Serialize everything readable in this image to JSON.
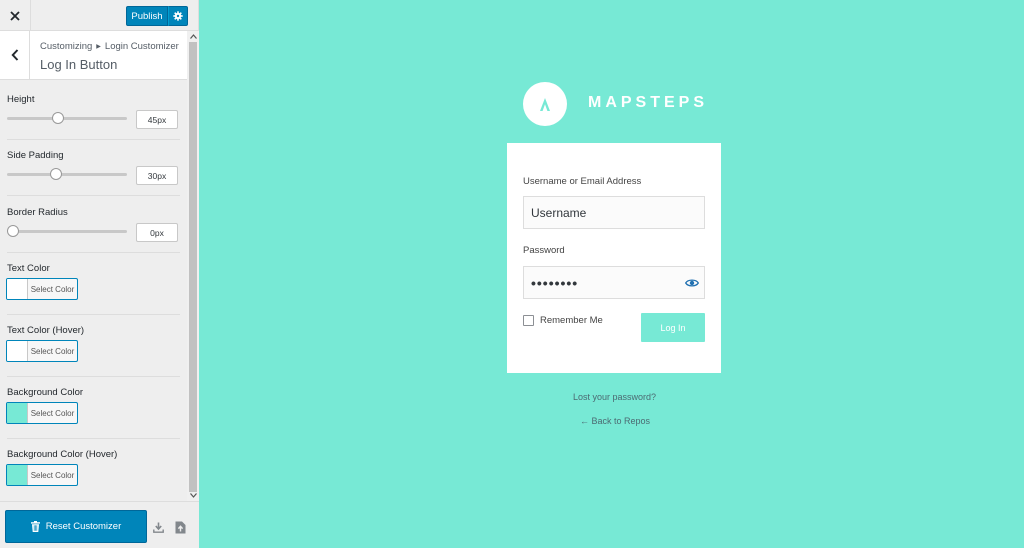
{
  "topbar": {
    "close_icon": "close-icon",
    "publish_label": "Publish",
    "gear_icon": "gear-icon"
  },
  "section": {
    "breadcrumb_root": "Customizing",
    "breadcrumb_child": "Login Customizer",
    "title": "Log In Button"
  },
  "controls": {
    "height": {
      "label": "Height",
      "value": "45px",
      "level": 0.42
    },
    "side_padding": {
      "label": "Side Padding",
      "value": "30px",
      "level": 0.4
    },
    "border_radius": {
      "label": "Border Radius",
      "value": "0px",
      "level": 0.0
    },
    "text_color": {
      "label": "Text Color",
      "button": "Select Color",
      "swatch": "#ffffff"
    },
    "text_color_hover": {
      "label": "Text Color (Hover)",
      "button": "Select Color",
      "swatch": "#ffffff"
    },
    "background_color": {
      "label": "Background Color",
      "button": "Select Color",
      "swatch": "#77e9d5"
    },
    "background_color_hover": {
      "label": "Background Color (Hover)",
      "button": "Select Color",
      "swatch": "#77e9d5"
    }
  },
  "footer": {
    "reset_label": "Reset Customizer",
    "export_icon": "download-icon",
    "import_icon": "upload-file-icon"
  },
  "preview": {
    "background": "#77e9d5",
    "brand_name": "MAPSTEPS",
    "username_label": "Username or Email Address",
    "username_value": "Username",
    "password_label": "Password",
    "password_value": "••••••••",
    "remember_label": "Remember Me",
    "login_button": "Log In",
    "lost_password": "Lost your password?",
    "back_link": "← Back to Repos"
  },
  "colors": {
    "accent": "#0085ba",
    "preview_bg": "#77e9d5"
  }
}
